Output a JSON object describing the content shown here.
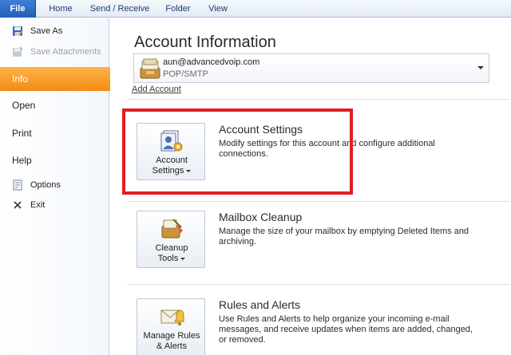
{
  "ribbon": {
    "tabs": [
      "File",
      "Home",
      "Send / Receive",
      "Folder",
      "View"
    ]
  },
  "nav": {
    "save_as": "Save As",
    "save_attachments": "Save Attachments",
    "info": "Info",
    "open": "Open",
    "print": "Print",
    "help": "Help",
    "options": "Options",
    "exit": "Exit"
  },
  "main": {
    "title": "Account Information",
    "account": {
      "email": "aun@advancedvoip.com",
      "type": "POP/SMTP"
    },
    "add_account": "Add Account",
    "sections": [
      {
        "button_line1": "Account",
        "button_line2": "Settings",
        "title": "Account Settings",
        "description": "Modify settings for this account and configure additional connections."
      },
      {
        "button_line1": "Cleanup",
        "button_line2": "Tools",
        "title": "Mailbox Cleanup",
        "description": "Manage the size of your mailbox by emptying Deleted Items and archiving."
      },
      {
        "button_line1": "Manage Rules",
        "button_line2": "& Alerts",
        "title": "Rules and Alerts",
        "description": "Use Rules and Alerts to help organize your incoming e-mail messages, and receive updates when items are added, changed, or removed."
      }
    ]
  },
  "colors": {
    "file_tab": "#2f6fc8",
    "selected_nav": "#f38a12",
    "highlight_box": "#e21d23"
  },
  "icons": [
    "save-as-icon",
    "save-attachments-icon",
    "options-icon",
    "exit-icon",
    "account-icon",
    "account-settings-icon",
    "cleanup-tools-icon",
    "rules-alerts-icon",
    "dropdown-arrow-icon"
  ]
}
